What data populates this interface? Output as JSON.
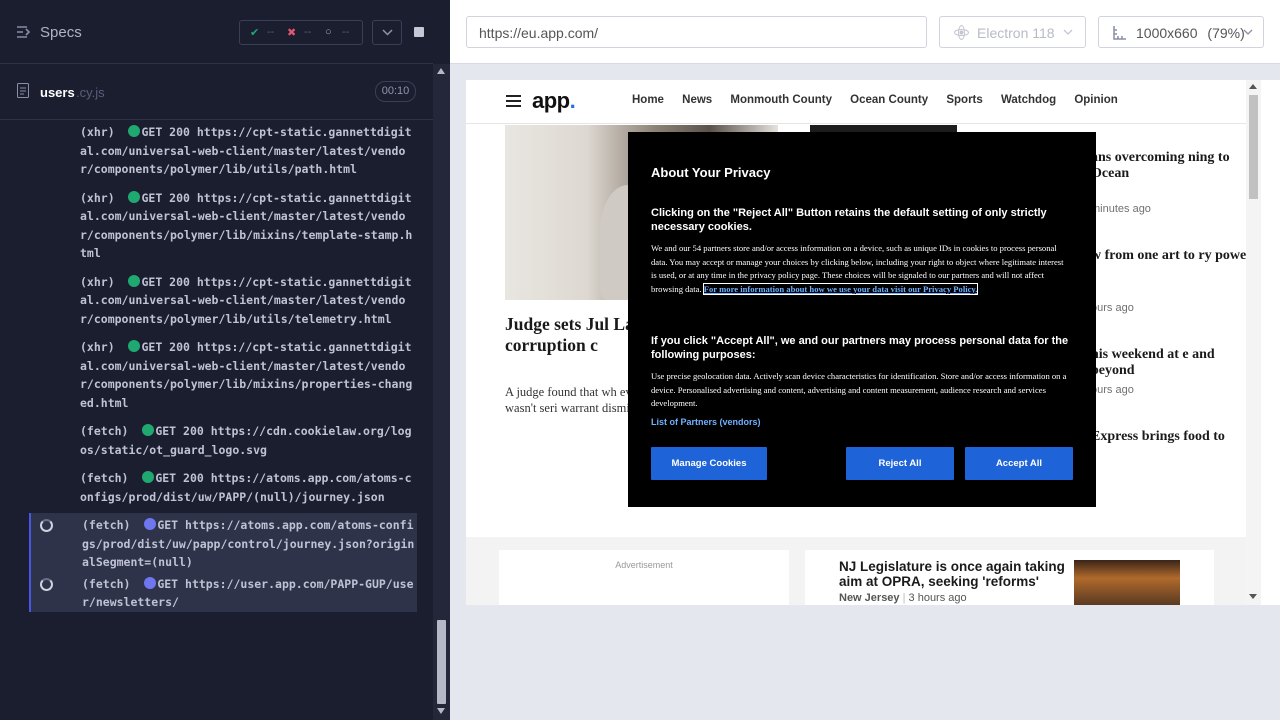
{
  "runner": {
    "specs_label": "Specs",
    "stats": {
      "passed": "--",
      "failed": "--",
      "pending": "--"
    },
    "spec_file": {
      "name": "users",
      "ext": ".cy.js",
      "timer": "00:10"
    },
    "log": [
      {
        "kind": "(xhr)",
        "status_color": "#1fa971",
        "text": "GET 200 https://cpt-static.gannettdigital.com/universal-web-client/master/latest/vendor/components/polymer/lib/utils/path.html"
      },
      {
        "kind": "(xhr)",
        "status_color": "#1fa971",
        "text": "GET 200 https://cpt-static.gannettdigital.com/universal-web-client/master/latest/vendor/components/polymer/lib/mixins/template-stamp.html"
      },
      {
        "kind": "(xhr)",
        "status_color": "#1fa971",
        "text": "GET 200 https://cpt-static.gannettdigital.com/universal-web-client/master/latest/vendor/components/polymer/lib/utils/telemetry.html"
      },
      {
        "kind": "(xhr)",
        "status_color": "#1fa971",
        "text": "GET 200 https://cpt-static.gannettdigital.com/universal-web-client/master/latest/vendor/components/polymer/lib/mixins/properties-changed.html"
      },
      {
        "kind": "(fetch)",
        "status_color": "#1fa971",
        "text": "GET 200 https://cdn.cookielaw.org/logos/static/ot_guard_logo.svg"
      },
      {
        "kind": "(fetch)",
        "status_color": "#1fa971",
        "text": "GET 200 https://atoms.app.com/atoms-configs/prod/dist/uw/PAPP/(null)/journey.json"
      },
      {
        "kind": "(fetch)",
        "status_color": "#6e76f0",
        "text": "GET https://atoms.app.com/atoms-configs/prod/dist/uw/papp/control/journey.json?originalSegment=(null)",
        "pending": true
      },
      {
        "kind": "(fetch)",
        "status_color": "#6e76f0",
        "text": "GET https://user.app.com/PAPP-GUP/user/newsletters/",
        "pending": true
      }
    ]
  },
  "browser": {
    "url": "https://eu.app.com/",
    "browser_name": "Electron 118",
    "viewport_label": "1000x660",
    "zoom": "(79%)"
  },
  "site": {
    "logo": "app",
    "logo_dot": ".",
    "nav": [
      "Home",
      "News",
      "Monmouth County",
      "Ocean County",
      "Sports",
      "Watchdog",
      "Opinion"
    ],
    "headline": "Judge sets Jul Lakewood SCH on corruption c",
    "summary": "A judge found that wh evidence from Rabbi C the breach wasn't seri warrant dismissal of t",
    "side_stories": [
      {
        "title": "ans overcoming ning to Ocean",
        "time": "minutes ago"
      },
      {
        "title": "w from one art to ry power",
        "time": "ours ago"
      },
      {
        "title": "his weekend at e and beyond",
        "time": "ours ago"
      },
      {
        "title": "Express brings food to",
        "time": ""
      }
    ],
    "ad_label": "Advertisement",
    "card": {
      "title": "NJ Legislature is once again taking aim at OPRA, seeking 'reforms'",
      "section": "New Jersey",
      "time": "3 hours ago"
    }
  },
  "privacy": {
    "title": "About Your Privacy",
    "h1": "Clicking on the \"Reject All\" Button retains the default setting of only strictly necessary cookies.",
    "p1": "We and our 54 partners store and/or access information on a device, such as unique IDs in cookies to process personal data. You may accept or manage your choices by clicking below, including your right to object where legitimate interest is used, or at any time in the privacy policy page. These choices will be signaled to our partners and will not affect browsing data.",
    "p1_link": "For more information about how we use your data visit our Privacy Policy.",
    "h2": "If you click \"Accept All\", we and our partners may process personal data for the following purposes:",
    "p2": "Use precise geolocation data. Actively scan device characteristics for identification. Store and/or access information on a device. Personalised advertising and content, advertising and content measurement, audience research and services development.",
    "vendors_link": "List of Partners (vendors)",
    "buttons": {
      "manage": "Manage Cookies",
      "reject": "Reject All",
      "accept": "Accept All"
    }
  }
}
